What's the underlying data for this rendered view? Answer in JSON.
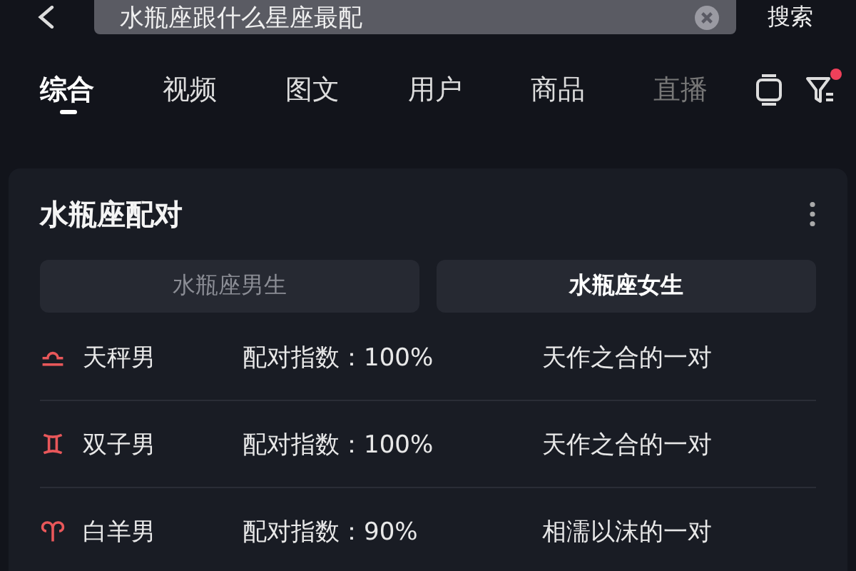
{
  "search": {
    "value": "水瓶座跟什么星座最配",
    "button": "搜索"
  },
  "tabs": [
    {
      "label": "综合",
      "selected": true
    },
    {
      "label": "视频",
      "selected": false
    },
    {
      "label": "图文",
      "selected": false
    },
    {
      "label": "用户",
      "selected": false
    },
    {
      "label": "商品",
      "selected": false
    },
    {
      "label": "直播",
      "selected": false
    }
  ],
  "filter": {
    "has_dot": true
  },
  "card": {
    "title": "水瓶座配对",
    "toggles": [
      {
        "label": "水瓶座男生",
        "selected": false
      },
      {
        "label": "水瓶座女生",
        "selected": true
      }
    ],
    "rows": [
      {
        "kind": "libra",
        "sign": "天秤男",
        "score": "配对指数：100%",
        "verdict": "天作之合的一对"
      },
      {
        "kind": "gemini",
        "sign": "双子男",
        "score": "配对指数：100%",
        "verdict": "天作之合的一对"
      },
      {
        "kind": "aries",
        "sign": "白羊男",
        "score": "配对指数：90%",
        "verdict": "相濡以沫的一对"
      }
    ]
  }
}
